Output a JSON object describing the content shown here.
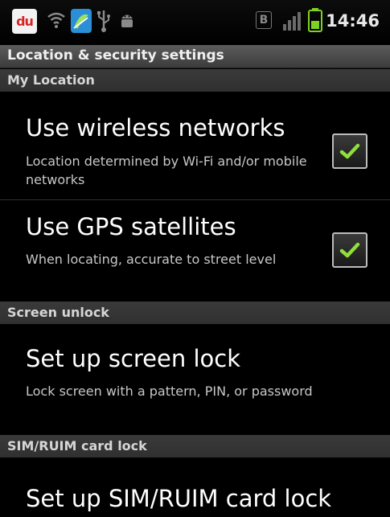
{
  "status_bar": {
    "app_badge": "du",
    "indicator_letter": "B",
    "time": "14:46",
    "battery_color": "#7ed321"
  },
  "title_bar": {
    "title": "Location & security settings"
  },
  "sections": [
    {
      "header": "My Location",
      "items": [
        {
          "title": "Use wireless networks",
          "summary": "Location determined by Wi-Fi and/or mobile networks",
          "checked": true
        },
        {
          "title": "Use GPS satellites",
          "summary": "When locating, accurate to street level",
          "checked": true
        }
      ]
    },
    {
      "header": "Screen unlock",
      "items": [
        {
          "title": "Set up screen lock",
          "summary": "Lock screen with a pattern, PIN, or password"
        }
      ]
    },
    {
      "header": "SIM/RUIM card lock",
      "items": [
        {
          "title": "Set up SIM/RUIM card lock"
        }
      ]
    }
  ],
  "colors": {
    "check_green": "#8fe03a",
    "background": "#000000",
    "section_header": "#363636"
  },
  "icons": [
    "du-app-icon",
    "wifi-icon",
    "app-notification-icon",
    "usb-icon",
    "android-debug-icon",
    "signal-icon",
    "battery-icon",
    "checkmark-icon"
  ]
}
